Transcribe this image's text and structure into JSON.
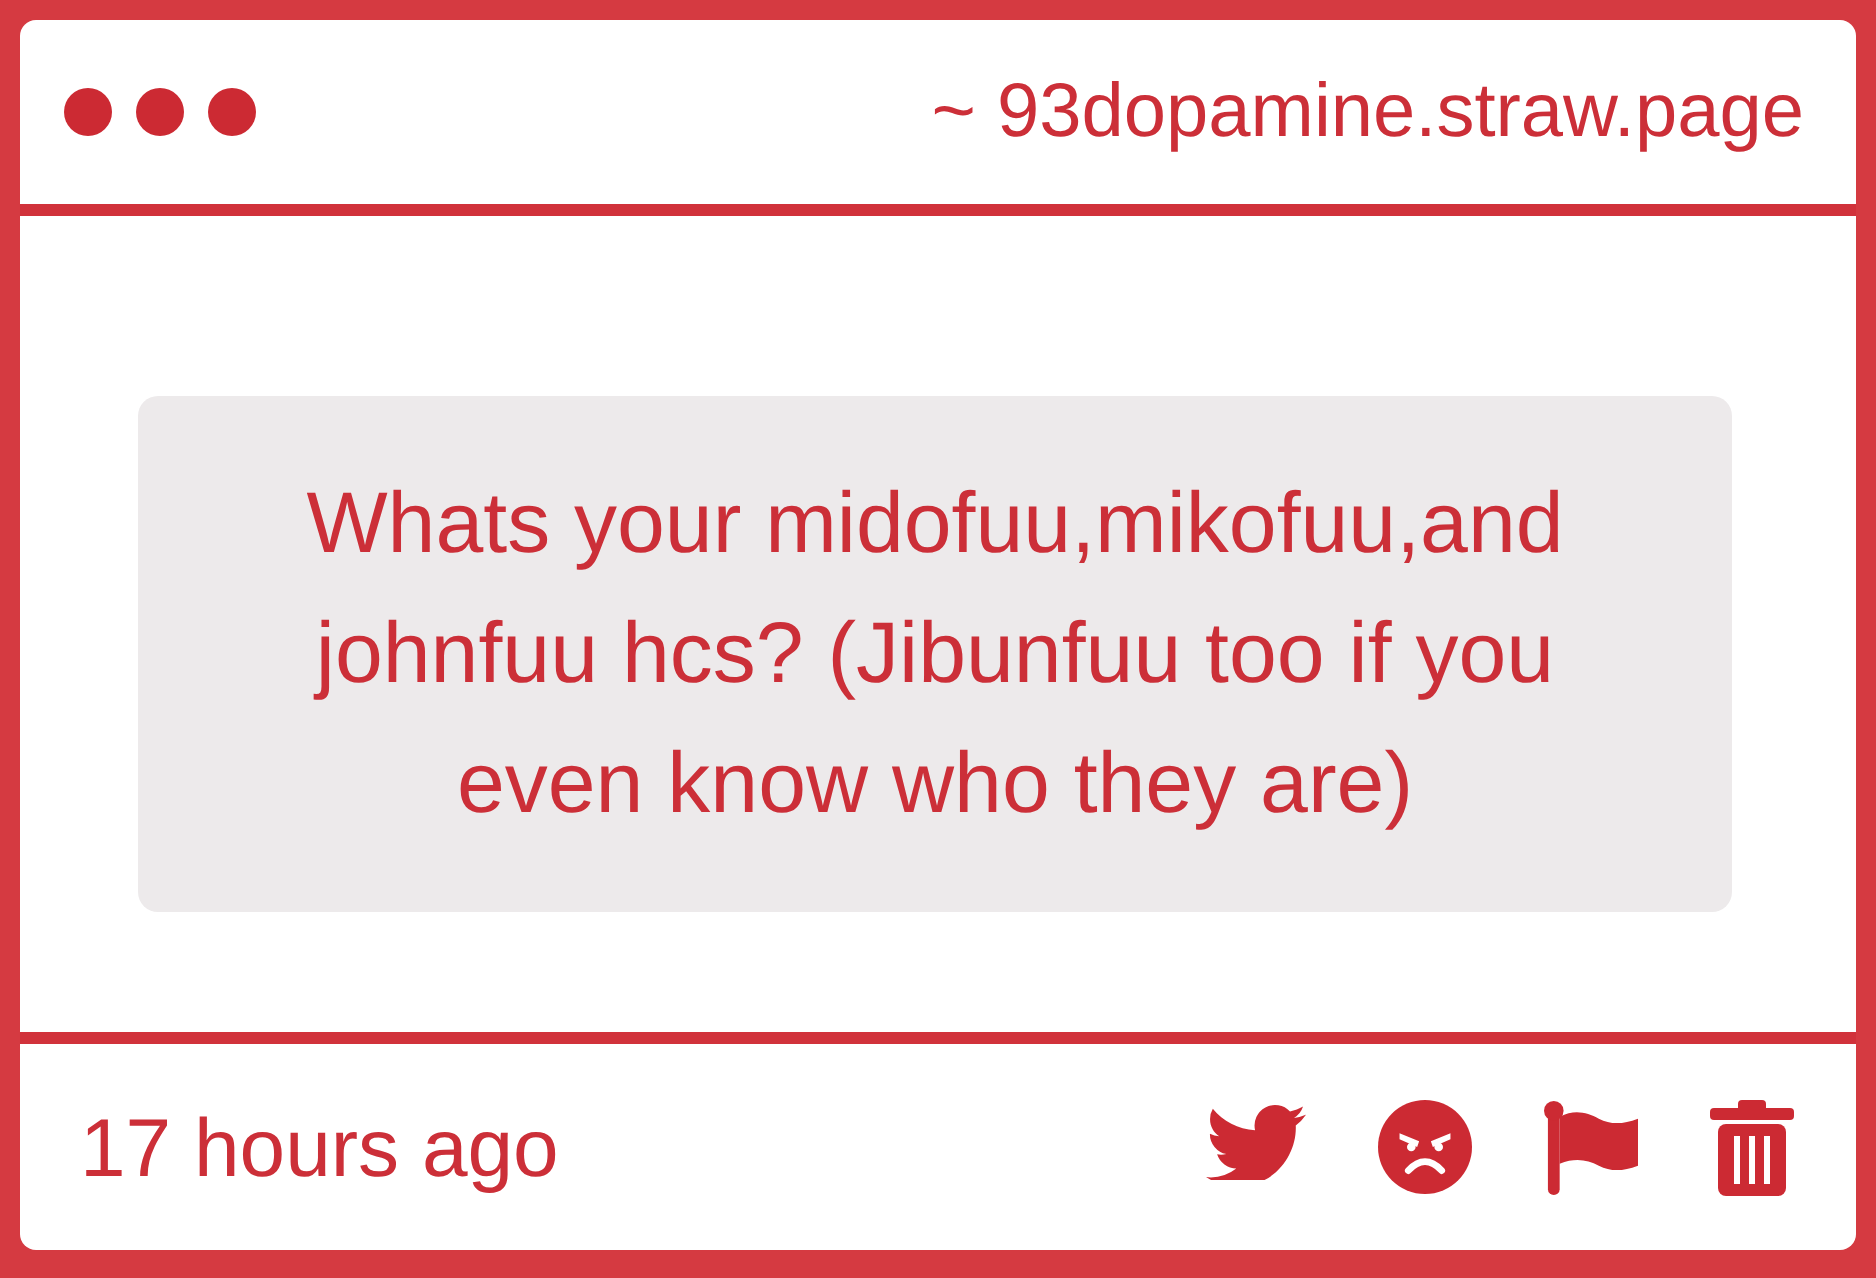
{
  "header": {
    "site": "~ 93dopamine.straw.page"
  },
  "question": {
    "text": "Whats your midofuu,mikofuu,and johnfuu hcs? (Jibunfuu too if you even know who they are)"
  },
  "footer": {
    "time": "17 hours ago"
  }
}
